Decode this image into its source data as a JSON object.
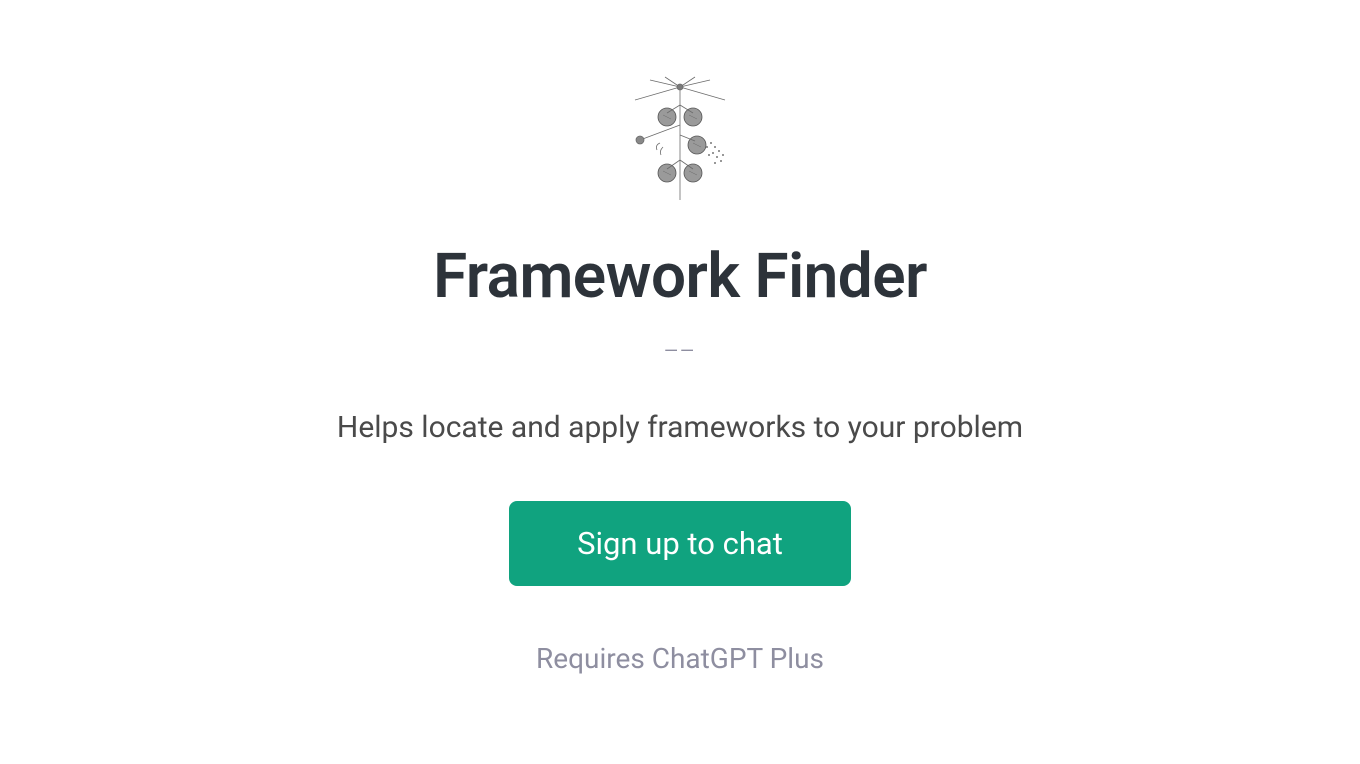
{
  "logo": {
    "icon_name": "botanical-sketch-icon"
  },
  "title": "Framework Finder",
  "author": "——",
  "description": "Helps locate and apply frameworks to your problem",
  "cta": {
    "label": "Sign up to chat"
  },
  "footer": {
    "requirement": "Requires ChatGPT Plus"
  },
  "colors": {
    "accent": "#10a37f",
    "text_primary": "#2d333a",
    "text_secondary": "#4a4a4a",
    "text_muted": "#8e8ea0"
  }
}
